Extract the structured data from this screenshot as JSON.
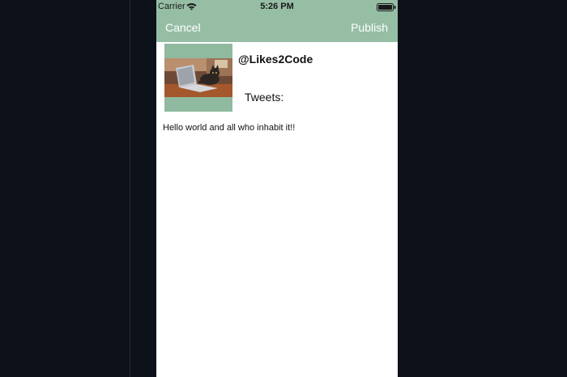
{
  "status_bar": {
    "carrier": "Carrier",
    "time": "5:26 PM",
    "icons": [
      "wifi-icon",
      "battery-icon"
    ]
  },
  "nav_bar": {
    "cancel_label": "Cancel",
    "publish_label": "Publish",
    "background": "#96bea5"
  },
  "profile": {
    "handle": "@Likes2Code",
    "tweets_label": "Tweets:",
    "avatar": "cat-on-laptop-photo"
  },
  "compose": {
    "text": "Hello world and all who inhabit it!!"
  },
  "colors": {
    "accent": "#96bea5",
    "page_background": "#0d1119",
    "content_background": "#ffffff"
  }
}
